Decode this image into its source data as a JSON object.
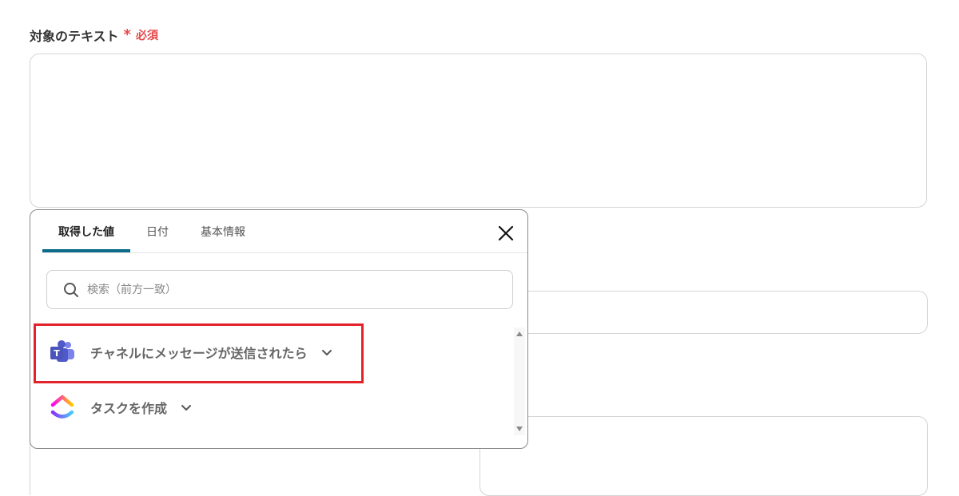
{
  "field": {
    "label": "対象のテキスト",
    "required_star": "*",
    "required_text": "必須"
  },
  "popup": {
    "tabs": [
      {
        "label": "取得した値",
        "active": true
      },
      {
        "label": "日付",
        "active": false
      },
      {
        "label": "基本情報",
        "active": false
      }
    ],
    "search": {
      "placeholder": "検索（前方一致）"
    },
    "items": [
      {
        "label": "チャネルにメッセージが送信されたら",
        "icon": "microsoft-teams-icon"
      },
      {
        "label": "タスクを作成",
        "icon": "clickup-icon"
      }
    ]
  },
  "colors": {
    "accent": "#0b6b8a",
    "required": "#e5484d",
    "highlight": "#e3232a"
  }
}
